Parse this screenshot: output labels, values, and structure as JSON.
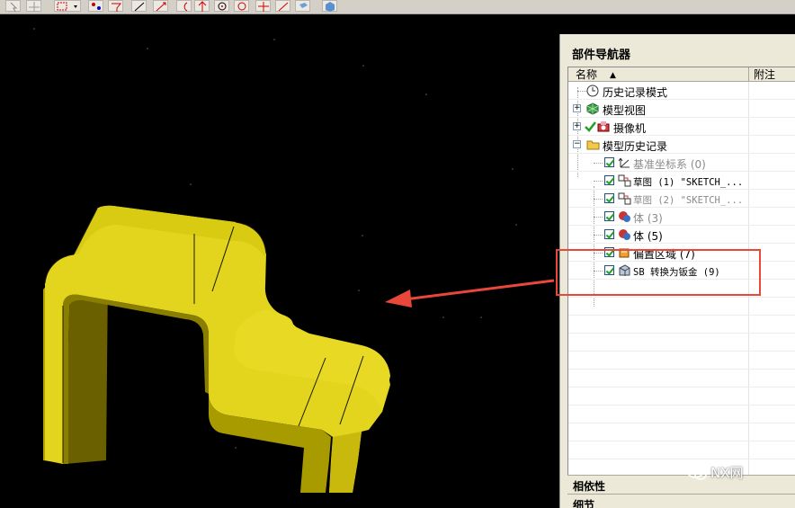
{
  "navigator": {
    "title": "部件导航器",
    "columns": {
      "name": "名称",
      "sort_indicator": "▲",
      "note": "附注"
    },
    "rows": [
      {
        "label": "历史记录模式",
        "dim": false,
        "icon": "clock-icon"
      },
      {
        "label": "模型视图",
        "dim": false,
        "icon": "model-view-icon",
        "expander": "+"
      },
      {
        "label": "摄像机",
        "dim": false,
        "icon": "camera-icon",
        "expander": "+"
      },
      {
        "label": "模型历史记录",
        "dim": false,
        "icon": "folder-icon",
        "expander": "−"
      },
      {
        "label": "基准坐标系 (0)",
        "dim": true,
        "icon": "datum-csys-icon"
      },
      {
        "label": "草图 (1) \"SKETCH_...",
        "dim": false,
        "icon": "sketch-icon"
      },
      {
        "label": "草图 (2) \"SKETCH_...",
        "dim": true,
        "icon": "sketch-icon"
      },
      {
        "label": "体 (3)",
        "dim": true,
        "icon": "body-icon"
      },
      {
        "label": "体 (5)",
        "dim": false,
        "icon": "body-icon"
      },
      {
        "label": "偏置区域 (7)",
        "dim": false,
        "icon": "offset-region-icon"
      },
      {
        "label": "SB 转换为钣金 (9)",
        "dim": false,
        "icon": "sheet-metal-icon"
      }
    ]
  },
  "panels": {
    "dependencies": "相依性",
    "details": "细节"
  },
  "watermark": "NX网",
  "colors": {
    "part": "#e8d81c",
    "part_dark": "#9c9000",
    "annotation": "#e8473a",
    "navigator_bg": "#ece9d8"
  }
}
